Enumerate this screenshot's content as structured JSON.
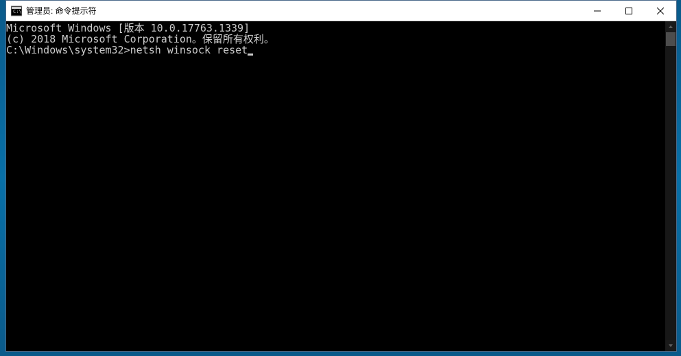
{
  "window": {
    "title": "管理员: 命令提示符"
  },
  "terminal": {
    "line1": "Microsoft Windows [版本 10.0.17763.1339]",
    "line2": "(c) 2018 Microsoft Corporation。保留所有权利。",
    "line3": "",
    "prompt": "C:\\Windows\\system32>",
    "command": "netsh winsock reset"
  }
}
